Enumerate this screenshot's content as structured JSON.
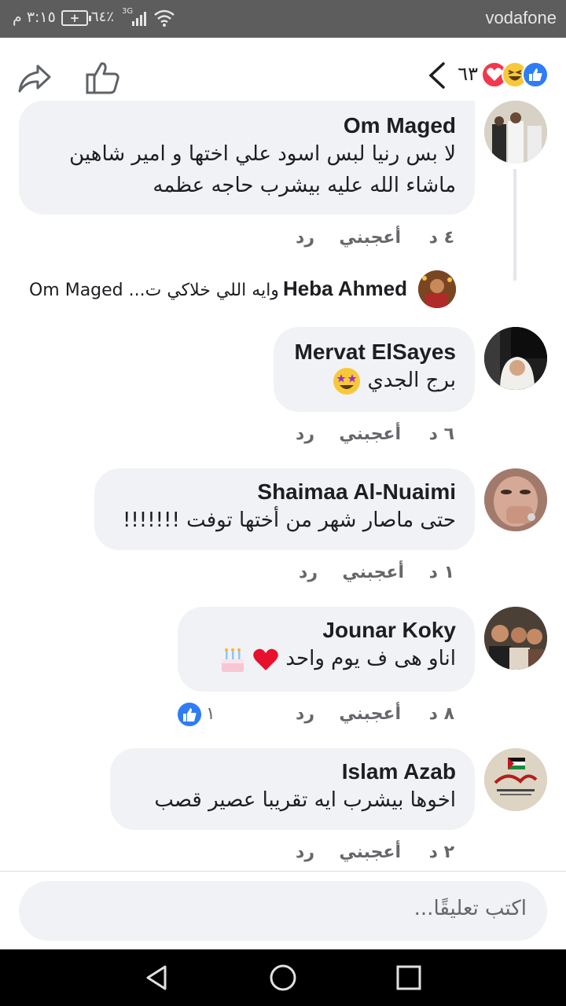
{
  "status_bar": {
    "carrier": "vodafone",
    "time": "٣:١٥ م",
    "battery_pct": "٦٤٪",
    "network": "3G"
  },
  "header": {
    "reaction_count": "٦٣",
    "reactions": [
      "like",
      "haha",
      "love"
    ],
    "colors": {
      "like": "#2e7cf6",
      "haha": "#f7c83a",
      "love": "#f1384e"
    }
  },
  "comments": [
    {
      "author": "Om Maged",
      "lines": [
        "لا بس رنيا لبس اسود علي اختها  و امير شاهين",
        "ماشاء الله عليه بيشرب حاجه عظمه"
      ],
      "time": "٤ د",
      "like_label": "أعجبني",
      "reply_label": "رد"
    },
    {
      "author": "Mervat ElSayes",
      "lines": [
        "برج الجدي"
      ],
      "emoji": "star-struck",
      "time": "٦ د",
      "like_label": "أعجبني",
      "reply_label": "رد"
    },
    {
      "author": "Shaimaa Al-Nuaimi",
      "lines": [
        "حتى ماصار شهر من أختها توفت !!!!!!!"
      ],
      "time": "١ د",
      "like_label": "أعجبني",
      "reply_label": "رد"
    },
    {
      "author": "Jounar Koky",
      "lines": [
        "اناو هى ف يوم واحد"
      ],
      "emoji": "heart-cake",
      "time": "٨ د",
      "like_label": "أعجبني",
      "reply_label": "رد",
      "like_count": "١"
    },
    {
      "author": "Islam Azab",
      "lines": [
        "اخوها بيشرب ايه تقريبا عصير قصب"
      ],
      "time": "٢ د",
      "like_label": "أعجبني",
      "reply_label": "رد"
    }
  ],
  "reply_preview": {
    "author": "Heba Ahmed",
    "text": "وايه اللي خلاكي ت... Om Maged"
  },
  "composer": {
    "placeholder": "اكتب تعليقًا..."
  }
}
